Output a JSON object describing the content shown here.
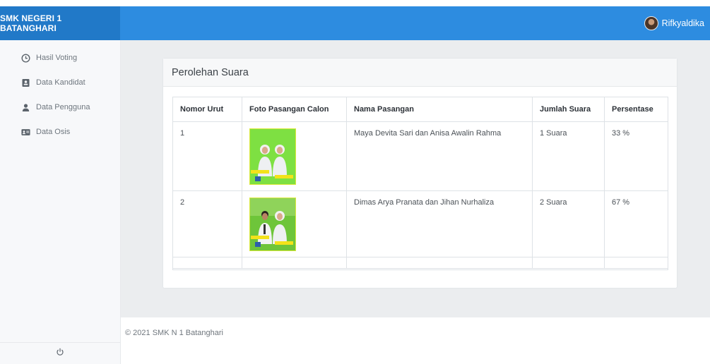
{
  "brand": "SMK NEGERI 1 BATANGHARI",
  "user": {
    "name": "Rifkyaldika"
  },
  "sidebar": {
    "items": [
      {
        "label": "Hasil Voting",
        "icon": "clock-icon"
      },
      {
        "label": "Data Kandidat",
        "icon": "id-card-icon"
      },
      {
        "label": "Data Pengguna",
        "icon": "user-icon"
      },
      {
        "label": "Data Osis",
        "icon": "address-card-icon"
      }
    ]
  },
  "card": {
    "title": "Perolehan Suara"
  },
  "table": {
    "headers": [
      "Nomor Urut",
      "Foto Pasangan Calon",
      "Nama Pasangan",
      "Jumlah Suara",
      "Persentase"
    ],
    "rows": [
      {
        "nomor": "1",
        "nama": "Maya Devita Sari dan Anisa Awalin Rahma",
        "jumlah": "1 Suara",
        "persen": "33 %"
      },
      {
        "nomor": "2",
        "nama": "Dimas Arya Pranata dan Jihan Nurhaliza",
        "jumlah": "2 Suara",
        "persen": "67 %"
      }
    ]
  },
  "footer": {
    "text": "© 2021 SMK N 1 Batanghari"
  },
  "colors": {
    "topbar": "#2d8ce0",
    "brand_bg": "#2179c8",
    "main_bg": "#ebedef"
  }
}
